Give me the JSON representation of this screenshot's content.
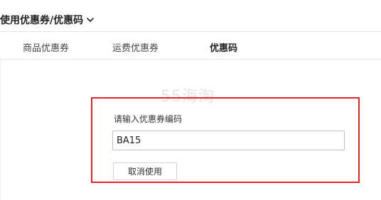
{
  "header": {
    "title": "使用优惠券/优惠码",
    "chevron_icon": "chevron-down-icon"
  },
  "tabs": [
    {
      "label": "商品优惠券",
      "active": false
    },
    {
      "label": "运费优惠券",
      "active": false
    },
    {
      "label": "优惠码",
      "active": true
    }
  ],
  "watermark": "55海淘",
  "coupon_form": {
    "label": "请输入优惠券编码",
    "input_value": "BA15",
    "cancel_label": "取消使用"
  },
  "colors": {
    "highlight": "#e8222a",
    "border": "#e6e6e6",
    "text": "#333333"
  }
}
